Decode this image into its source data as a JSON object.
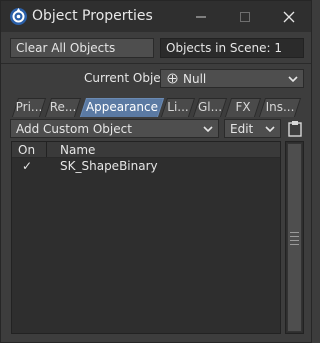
{
  "window": {
    "title": "Object Properties"
  },
  "toolbar": {
    "clear_all_label": "Clear All Objects",
    "objects_in_scene": "Objects in Scene: 1"
  },
  "current_object": {
    "label": "Current Object",
    "value": "Null"
  },
  "tabs": [
    {
      "label": "Pri..."
    },
    {
      "label": "Re..."
    },
    {
      "label": "Appearance"
    },
    {
      "label": "Li..."
    },
    {
      "label": "Gl..."
    },
    {
      "label": "FX"
    },
    {
      "label": "Ins..."
    }
  ],
  "custom_object": {
    "add_label": "Add Custom Object",
    "edit_label": "Edit"
  },
  "list": {
    "col_on": "On",
    "col_name": "Name",
    "rows": [
      {
        "on": "✓",
        "name": "SK_ShapeBinary"
      }
    ]
  }
}
